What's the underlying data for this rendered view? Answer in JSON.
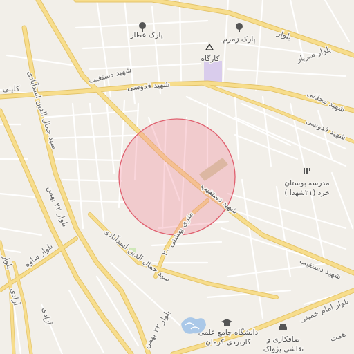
{
  "map": {
    "colors": {
      "background": "#f2efe9",
      "minor_road": "#ffffff",
      "major_road": "#f7dd8c",
      "major_road_casing": "#e4c46a",
      "circle_fill": "#f08a9a",
      "circle_stroke": "#e0606f",
      "park": "#cfe8b8",
      "building_zone": "#d9ccec"
    },
    "streets": {
      "bolvar_sarbaz": "بلوار سرباز",
      "shahid_ghodousi_top": "شهید قدوسی",
      "shahid_dastgheib_top": "شهید دستغیب",
      "shahid_mahallati": "شهید محلاتی",
      "shahid_ghodousi_right": "شهید قدوسی",
      "sayyed_jamal_left": "سید جمال الدین اسدآبادی",
      "bolvar_22_bahman_left": "بلوار ۲۲ بهمن",
      "bolvar_saveh": "بلوار ساوه",
      "sayyed_jamal_bottom": "سید جمال الدین اسدآبادی",
      "shahid_dastgheib_mid": "شهید دستغیب",
      "twenty_meter_beheshti": "۲۰ متری بهشتی",
      "shahid_dastgheib_bottom": "شهید دستغیب",
      "azadi_1": "آزادی",
      "azadi_2": "آزادی",
      "bolvar_22_bahman_bottom": "بلوار ۲۲ بهمن",
      "imam_khomeini": "بلوار امام خمینی",
      "hemmat": "همت",
      "bolvar_top": "بلوار",
      "klini": "کلینی",
      "edge_left": "بلوار"
    },
    "pois": {
      "park_attar": "پارک عطار",
      "park_zamzam": "پارک زمزم",
      "kargah": "کارگاه",
      "school_line1": "مدرسه بوستان",
      "school_line2": "خرد (۲۱شهدا )",
      "university_line1": "دانشگاه جامع علمی",
      "university_line2": "کاربردی کرمان",
      "carwash_line1": "صافکاری و",
      "carwash_line2": "نقاشی پژواک"
    },
    "icons": {
      "park_attar": "tree-icon",
      "park_zamzam": "tree-icon",
      "kargah": "triangle-icon",
      "school": "school-icon",
      "university": "graduation-cap-icon",
      "carwash": "car-icon",
      "lake": "water-icon"
    }
  }
}
